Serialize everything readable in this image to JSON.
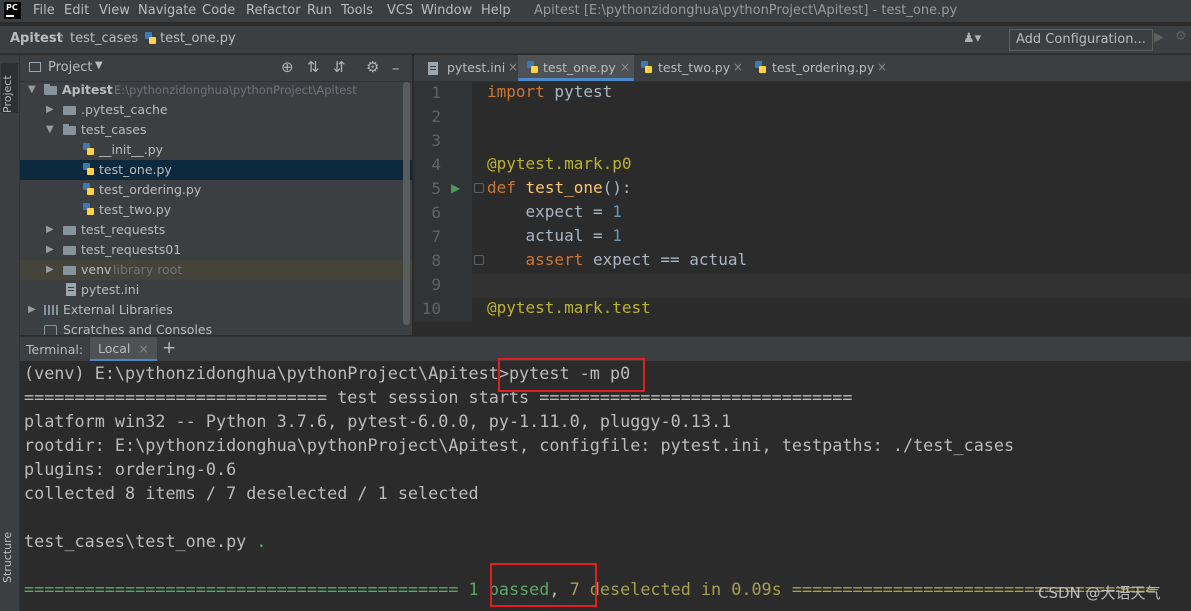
{
  "window": {
    "logo": "PC",
    "title": "Apitest [E:\\pythonzidonghua\\pythonProject\\Apitest] - test_one.py",
    "menu": [
      "File",
      "Edit",
      "View",
      "Navigate",
      "Code",
      "Refactor",
      "Run",
      "Tools",
      "VCS",
      "Window",
      "Help"
    ]
  },
  "breadcrumb": [
    "Apitest",
    "test_cases",
    "test_one.py"
  ],
  "toolbar": {
    "add_configuration": "Add Configuration..."
  },
  "left_strip": {
    "project_tab": "Project",
    "structure_tab": "Structure"
  },
  "project": {
    "header_label": "Project",
    "tree": [
      {
        "label": "Apitest",
        "hint": "E:\\pythonzidonghua\\pythonProject\\Apitest"
      },
      {
        "label": ".pytest_cache"
      },
      {
        "label": "test_cases"
      },
      {
        "label": "__init__.py"
      },
      {
        "label": "test_one.py"
      },
      {
        "label": "test_ordering.py"
      },
      {
        "label": "test_two.py"
      },
      {
        "label": "test_requests"
      },
      {
        "label": "test_requests01"
      },
      {
        "label": "venv",
        "hint": "library root"
      },
      {
        "label": "pytest.ini"
      },
      {
        "label": "External Libraries"
      },
      {
        "label": "Scratches and Consoles"
      }
    ]
  },
  "editor": {
    "tabs": [
      "pytest.ini",
      "test_one.py",
      "test_two.py",
      "test_ordering.py"
    ],
    "active_tab": "test_one.py",
    "line_numbers": [
      "1",
      "2",
      "3",
      "4",
      "5",
      "6",
      "7",
      "8",
      "9",
      "10"
    ],
    "code": {
      "l1_kw": "import",
      "l1_rest": " pytest",
      "l4": "@pytest.mark.p0",
      "l5_kw": "def",
      "l5_fn": "test_one",
      "l5_rest": "():",
      "l6_a": "    expect = ",
      "l6_n": "1",
      "l7_a": "    actual = ",
      "l7_n": "1",
      "l8_kw": "    assert",
      "l8_rest": " expect == actual",
      "l10": "@pytest.mark.test"
    }
  },
  "terminal": {
    "label": "Terminal:",
    "tab": "Local",
    "prompt": "(venv) E:\\pythonzidonghua\\pythonProject\\Apitest>",
    "command": "pytest -m p0",
    "session_line": "============================== test session starts ===============================",
    "platform": "platform win32 -- Python 3.7.6, pytest-6.0.0, py-1.11.0, pluggy-0.13.1",
    "rootdir": "rootdir: E:\\pythonzidonghua\\pythonProject\\Apitest, configfile: pytest.ini, testpaths: ./test_cases",
    "plugins": "plugins: ordering-0.6",
    "collected": "collected 8 items / 7 deselected / 1 selected",
    "test_file": "test_cases\\test_one.py",
    "test_dot": " .",
    "result_eq_left": "=========================================== ",
    "result_passed": "1 passed",
    "result_comma": ", ",
    "result_deselected": "7 deselected in 0.09s",
    "result_eq_right": " ===================================="
  },
  "watermark": "CSDN @大语天气",
  "colors": {
    "passed_green": "#59a869",
    "deselected_yellow": "#a6a050",
    "highlight_red": "#e11f1f",
    "keyword_orange": "#cc7832"
  }
}
